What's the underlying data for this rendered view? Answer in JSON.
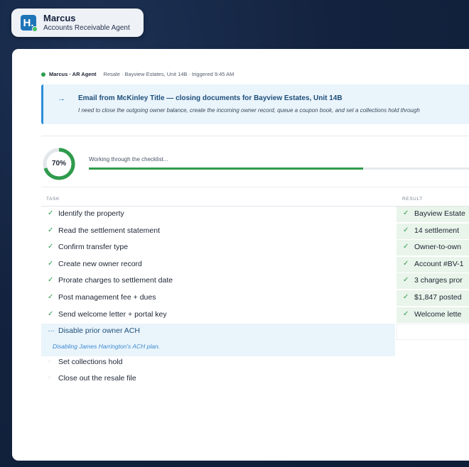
{
  "agent": {
    "logo_letter": "H.",
    "name": "Marcus",
    "role": "Accounts Receivable Agent"
  },
  "status": {
    "agent_label": "Marcus · AR Agent",
    "context": "Resale · Bayview Estates, Unit 14B · triggered 9:45 AM"
  },
  "email": {
    "arrow": "→",
    "title": "Email from McKinley Title — closing documents for Bayview Estates, Unit 14B",
    "body": "I need to close the outgoing owner balance, create the incoming owner record, queue a coupon book, and set a collections hold through"
  },
  "progress": {
    "percent_label": "70%",
    "percent": 70,
    "message": "Working through the checklist..."
  },
  "table": {
    "task_header": "TASK",
    "result_header": "RESULT",
    "rows": [
      {
        "task": "Identify the property",
        "status": "done",
        "result": "Bayview Estate"
      },
      {
        "task": "Read the settlement statement",
        "status": "done",
        "result": "14 settlement"
      },
      {
        "task": "Confirm transfer type",
        "status": "done",
        "result": "Owner-to-own"
      },
      {
        "task": "Create new owner record",
        "status": "done",
        "result": "Account #BV-1"
      },
      {
        "task": "Prorate charges to settlement date",
        "status": "done",
        "result": "3 charges pror"
      },
      {
        "task": "Post management fee + dues",
        "status": "done",
        "result": "$1,847 posted"
      },
      {
        "task": "Send welcome letter + portal key",
        "status": "done",
        "result": "Welcome lette"
      },
      {
        "task": "Disable prior owner ACH",
        "status": "working",
        "detail": "Disabling James Harrington's ACH plan.",
        "result": ""
      },
      {
        "task": "Set collections hold",
        "status": "pending",
        "result": ""
      },
      {
        "task": "Close out the resale file",
        "status": "pending",
        "result": ""
      }
    ]
  },
  "icons": {
    "done": "✓",
    "working": "…",
    "pending": "○"
  },
  "colors": {
    "accent_green": "#2f9b4c",
    "accent_blue": "#2a8fd6",
    "background_navy": "#13233f"
  }
}
